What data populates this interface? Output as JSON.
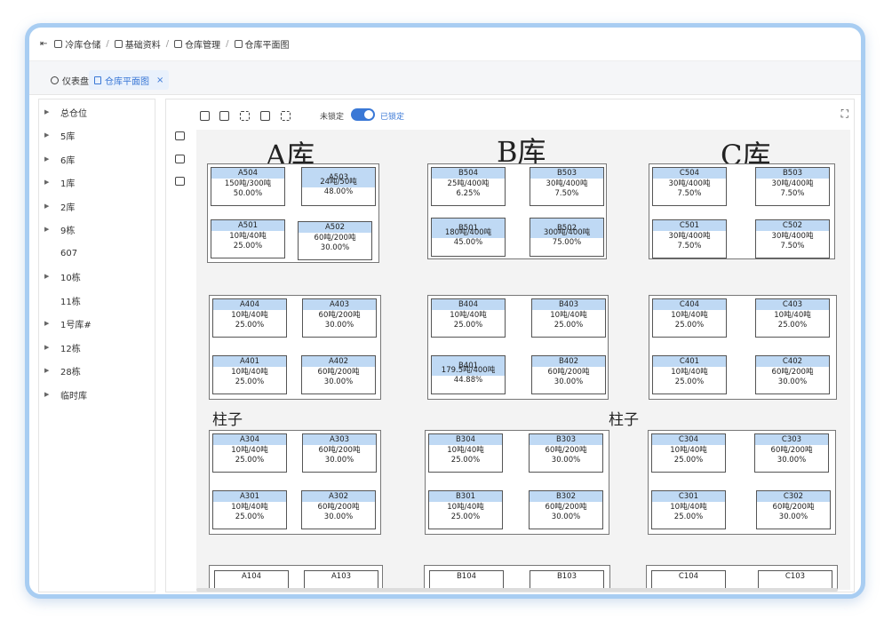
{
  "breadcrumb": [
    "冷库仓储",
    "基础资料",
    "仓库管理",
    "仓库平面图"
  ],
  "tabs": [
    {
      "label": "仪表盘",
      "active": false
    },
    {
      "label": "仓库平面图",
      "active": true
    }
  ],
  "sidebar": {
    "items": [
      {
        "label": "总仓位",
        "arrow": true
      },
      {
        "label": "5库",
        "arrow": true
      },
      {
        "label": "6库",
        "arrow": true
      },
      {
        "label": "1库",
        "arrow": true
      },
      {
        "label": "2库",
        "arrow": true
      },
      {
        "label": "9栋",
        "arrow": true
      },
      {
        "label": "607",
        "arrow": false
      },
      {
        "label": "10栋",
        "arrow": true
      },
      {
        "label": "11栋",
        "arrow": false
      },
      {
        "label": "1号库#",
        "arrow": true
      },
      {
        "label": "12栋",
        "arrow": true
      },
      {
        "label": "28栋",
        "arrow": true
      },
      {
        "label": "临时库",
        "arrow": true
      }
    ]
  },
  "toolbar": {
    "unlocked_label": "未锁定",
    "locked_label": "已锁定",
    "locked": true
  },
  "warehouses": [
    "A库",
    "B库",
    "C库"
  ],
  "pillar_label": "柱子",
  "cells": {
    "A504": {
      "cap": "150吨/300吨",
      "pct": "50.00%"
    },
    "A503": {
      "cap": "24吨/50吨",
      "pct": "48.00%"
    },
    "A501": {
      "cap": "10吨/40吨",
      "pct": "25.00%"
    },
    "A502": {
      "cap": "60吨/200吨",
      "pct": "30.00%"
    },
    "B504": {
      "cap": "25吨/400吨",
      "pct": "6.25%"
    },
    "B503": {
      "cap": "30吨/400吨",
      "pct": "7.50%"
    },
    "B501": {
      "cap": "180吨/400吨",
      "pct": "45.00%"
    },
    "B502": {
      "cap": "300吨/400吨",
      "pct": "75.00%"
    },
    "C504": {
      "cap": "30吨/400吨",
      "pct": "7.50%"
    },
    "B503c": {
      "name": "B503",
      "cap": "30吨/400吨",
      "pct": "7.50%"
    },
    "C501": {
      "cap": "30吨/400吨",
      "pct": "7.50%"
    },
    "C502": {
      "cap": "30吨/400吨",
      "pct": "7.50%"
    },
    "A404": {
      "cap": "10吨/40吨",
      "pct": "25.00%"
    },
    "A403": {
      "cap": "60吨/200吨",
      "pct": "30.00%"
    },
    "A401": {
      "cap": "10吨/40吨",
      "pct": "25.00%"
    },
    "A402": {
      "cap": "60吨/200吨",
      "pct": "30.00%"
    },
    "B404": {
      "cap": "10吨/40吨",
      "pct": "25.00%"
    },
    "B403": {
      "cap": "10吨/40吨",
      "pct": "25.00%"
    },
    "B401": {
      "cap": "179.5吨/400吨",
      "pct": "44.88%"
    },
    "B402": {
      "cap": "60吨/200吨",
      "pct": "30.00%"
    },
    "C404": {
      "cap": "10吨/40吨",
      "pct": "25.00%"
    },
    "C403": {
      "cap": "10吨/40吨",
      "pct": "25.00%"
    },
    "C401": {
      "cap": "10吨/40吨",
      "pct": "25.00%"
    },
    "C402": {
      "cap": "60吨/200吨",
      "pct": "30.00%"
    },
    "A304": {
      "cap": "10吨/40吨",
      "pct": "25.00%"
    },
    "A303": {
      "cap": "60吨/200吨",
      "pct": "30.00%"
    },
    "A301": {
      "cap": "10吨/40吨",
      "pct": "25.00%"
    },
    "A302": {
      "cap": "60吨/200吨",
      "pct": "30.00%"
    },
    "B304": {
      "cap": "10吨/40吨",
      "pct": "25.00%"
    },
    "B303": {
      "cap": "60吨/200吨",
      "pct": "30.00%"
    },
    "B301": {
      "cap": "10吨/40吨",
      "pct": "25.00%"
    },
    "B302": {
      "cap": "60吨/200吨",
      "pct": "30.00%"
    },
    "C304": {
      "cap": "10吨/40吨",
      "pct": "25.00%"
    },
    "C303": {
      "cap": "60吨/200吨",
      "pct": "30.00%"
    },
    "C301": {
      "cap": "10吨/40吨",
      "pct": "25.00%"
    },
    "C302": {
      "cap": "60吨/200吨",
      "pct": "30.00%"
    }
  },
  "bottom_row": [
    "A104",
    "A103",
    "B104",
    "B103",
    "C104",
    "C103"
  ]
}
